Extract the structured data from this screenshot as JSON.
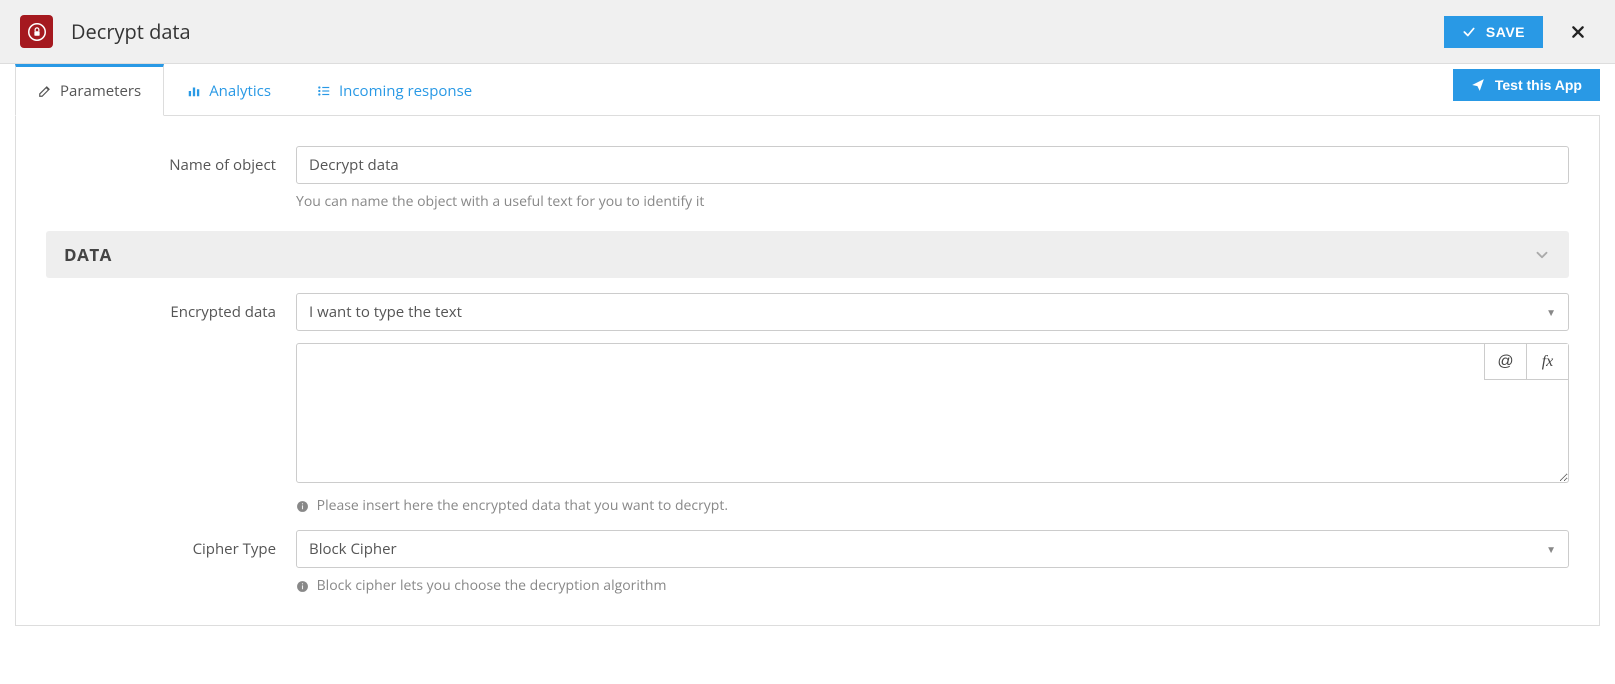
{
  "header": {
    "title": "Decrypt data",
    "save_label": "SAVE"
  },
  "tabs": {
    "parameters": "Parameters",
    "analytics": "Analytics",
    "incoming": "Incoming response",
    "test_label": "Test this App"
  },
  "form": {
    "name_label": "Name of object",
    "name_value": "Decrypt data",
    "name_help": "You can name the object with a useful text for you to identify it"
  },
  "section": {
    "data_title": "DATA"
  },
  "encrypted": {
    "label": "Encrypted data",
    "select_value": "I want to type the text",
    "text_value": "",
    "at_label": "@",
    "fx_label": "fx",
    "help": "Please insert here the encrypted data that you want to decrypt."
  },
  "cipher": {
    "label": "Cipher Type",
    "select_value": "Block Cipher",
    "help": "Block cipher lets you choose the decryption algorithm"
  }
}
